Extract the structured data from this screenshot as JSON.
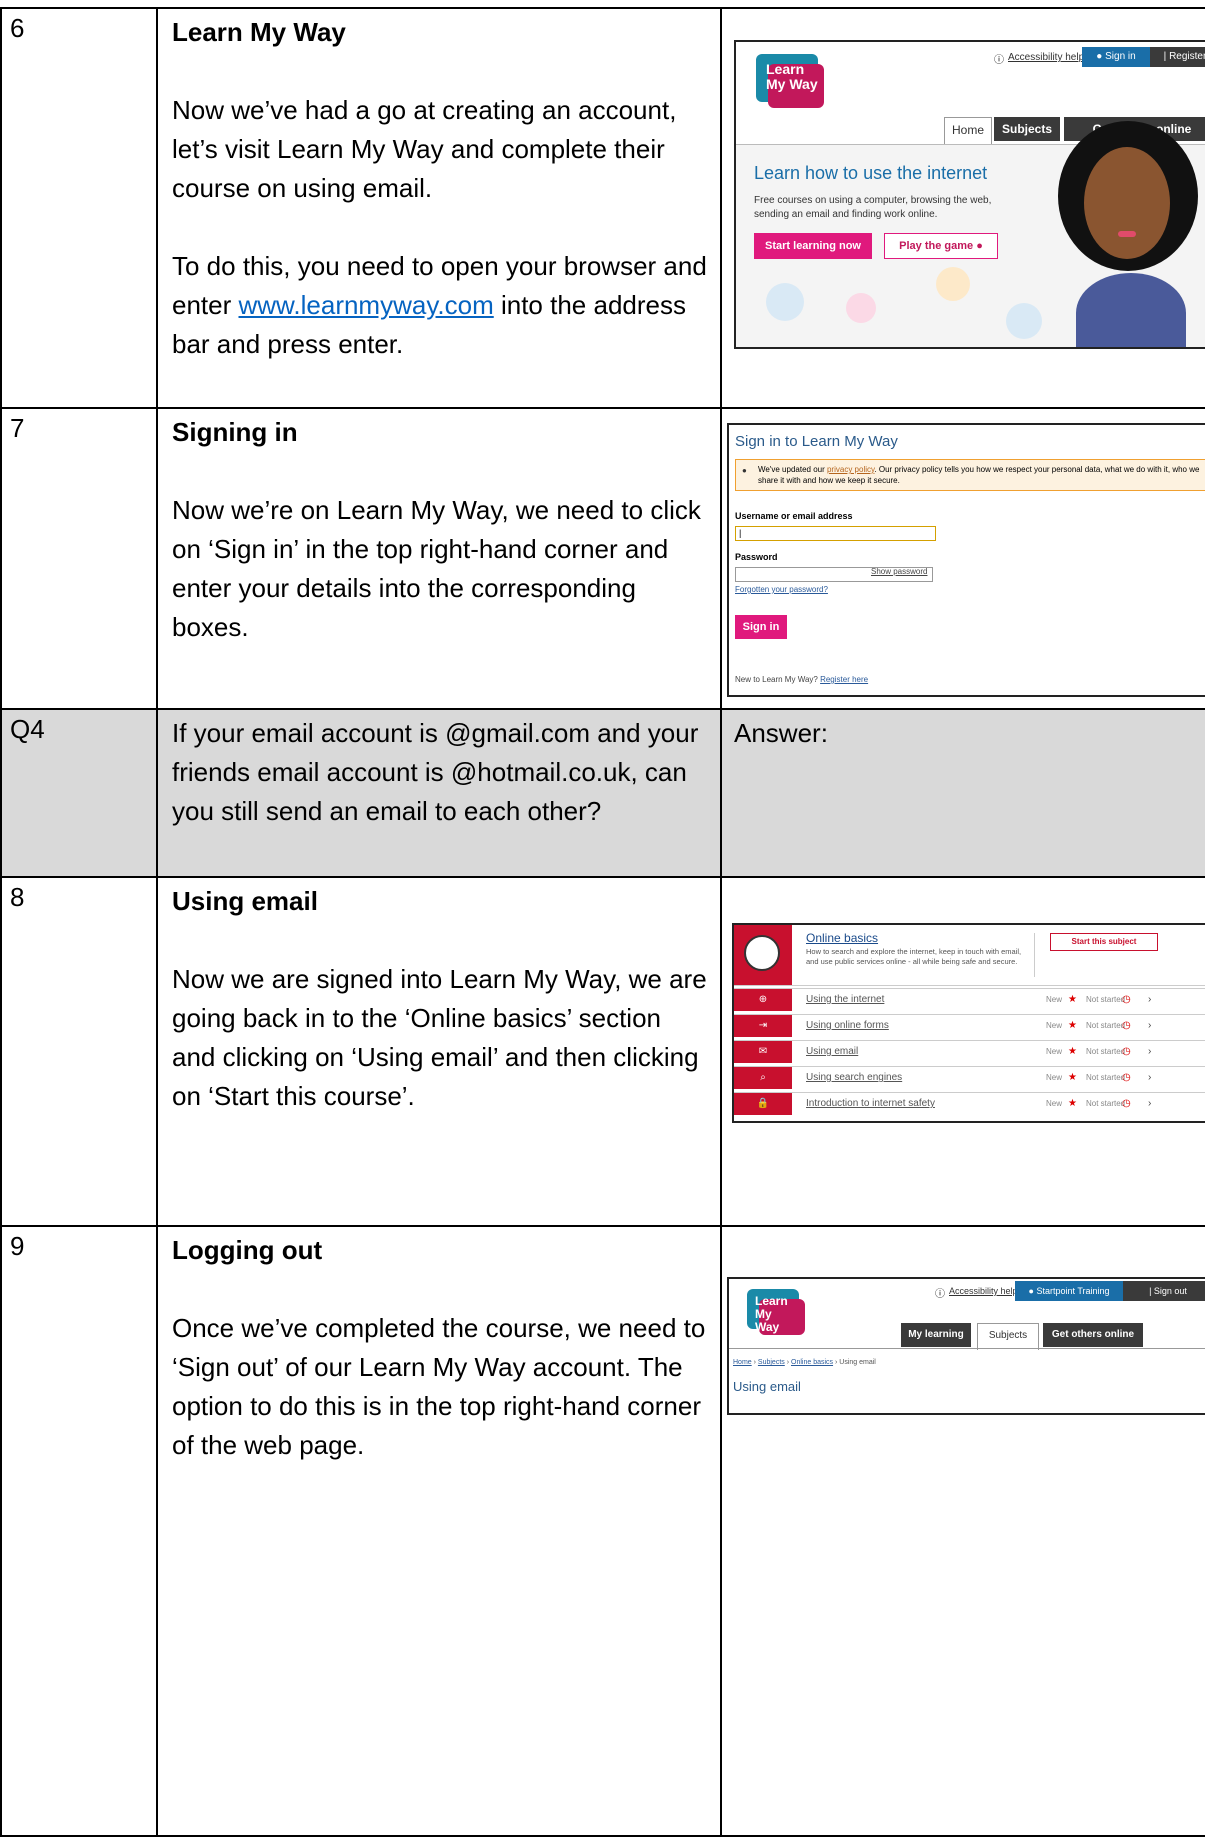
{
  "rows": [
    {
      "num": "6",
      "title": "Learn My Way",
      "para1": "Now we’ve had a go at creating an account, let’s visit Learn My Way and complete their course on using email.",
      "para2_before": "To do this, you need to open your browser and enter ",
      "para2_link": "www.learnmyway.com",
      "para2_after": " into the address bar and press enter."
    },
    {
      "num": "7",
      "title": "Signing in",
      "para1": "Now we’re on Learn My Way, we need to click on ‘Sign in’ in the top right-hand corner and enter your details into the corresponding boxes."
    },
    {
      "num": "Q4",
      "question": "If your email account is @gmail.com and your friends email account is @hotmail.co.uk, can you still send an email to each other?",
      "answer_label": "Answer:"
    },
    {
      "num": "8",
      "title": "Using email",
      "para1": "Now we are signed into Learn My Way, we are going back in to the ‘Online basics’ section and clicking on ‘Using email’ and then clicking on ‘Start this course’."
    },
    {
      "num": "9",
      "title": "Logging out",
      "para1": "Once we’ve completed the course, we need to ‘Sign out’ of our Learn My Way account. The option to do this is in the top right-hand corner of the web page."
    }
  ],
  "shot1": {
    "logo_line1": "Learn",
    "logo_line2": "My Way",
    "accessibility": "Accessibility help",
    "sign_in": "Sign in",
    "register": "Register",
    "tab_home": "Home",
    "tab_subjects": "Subjects",
    "tab_others": "Get others online",
    "headline": "Learn how to use the internet",
    "sub1": "Free courses on using a computer, browsing the web,",
    "sub2": "sending an email and finding work online.",
    "btn_start": "Start learning now",
    "btn_game": "Play the game"
  },
  "shot2": {
    "title": "Sign in to Learn My Way",
    "notice_before": "We've updated our ",
    "notice_link": "privacy policy",
    "notice_after": ". Our privacy policy tells you how we respect your personal data, what we do with it, who we share it with and how we keep it secure.",
    "username_label": "Username or email address",
    "password_label": "Password",
    "show_password": "Show password",
    "forgotten": "Forgotten your password?",
    "sign_in_btn": "Sign in",
    "new_text": "New to Learn My Way? ",
    "register_here": "Register here"
  },
  "shot3": {
    "subject_title": "Online basics",
    "subject_desc1": "How to search and explore the internet, keep in touch with email,",
    "subject_desc2": "and use public services online - all while being safe and secure.",
    "start_subject": "Start this subject",
    "new_label": "New",
    "status_label": "Not started",
    "courses": [
      {
        "label": "Using the internet",
        "icon": "globe-icon",
        "glyph": "⊕"
      },
      {
        "label": "Using online forms",
        "icon": "form-icon",
        "glyph": "⇥"
      },
      {
        "label": "Using email",
        "icon": "envelope-icon",
        "glyph": "✉"
      },
      {
        "label": "Using search engines",
        "icon": "search-icon",
        "glyph": "⌕"
      },
      {
        "label": "Introduction to internet safety",
        "icon": "lock-icon",
        "glyph": "🔒"
      }
    ]
  },
  "shot4": {
    "logo_line1": "Learn",
    "logo_line2": "My Way",
    "accessibility": "Accessibility help",
    "user": "Startpoint Training",
    "sign_out": "Sign out",
    "tab_learning": "My learning",
    "tab_subjects": "Subjects",
    "tab_others": "Get others online",
    "crumb_home": "Home",
    "crumb_subjects": "Subjects",
    "crumb_online": "Online basics",
    "crumb_current": "Using email",
    "page_title": "Using email"
  }
}
